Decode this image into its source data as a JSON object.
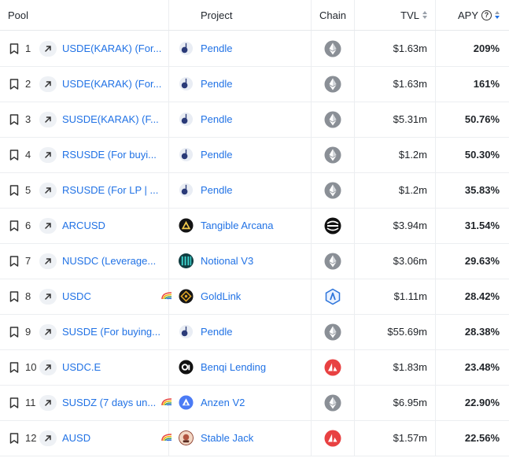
{
  "header": {
    "pool": "Pool",
    "project": "Project",
    "chain": "Chain",
    "tvl": "TVL",
    "apy": "APY",
    "apy_help": "?"
  },
  "rows": [
    {
      "rank": "1",
      "pool": "USDE(KARAK) (For...",
      "project": "Pendle",
      "project_icon": "pendle-icon",
      "chain": "ethereum-icon",
      "tvl": "$1.63m",
      "apy": "209%",
      "stable": false
    },
    {
      "rank": "2",
      "pool": "USDE(KARAK) (For...",
      "project": "Pendle",
      "project_icon": "pendle-icon",
      "chain": "ethereum-icon",
      "tvl": "$1.63m",
      "apy": "161%",
      "stable": false
    },
    {
      "rank": "3",
      "pool": "SUSDE(KARAK) (F...",
      "project": "Pendle",
      "project_icon": "pendle-icon",
      "chain": "ethereum-icon",
      "tvl": "$5.31m",
      "apy": "50.76%",
      "stable": false
    },
    {
      "rank": "4",
      "pool": "RSUSDE (For buyi...",
      "project": "Pendle",
      "project_icon": "pendle-icon",
      "chain": "ethereum-icon",
      "tvl": "$1.2m",
      "apy": "50.30%",
      "stable": false
    },
    {
      "rank": "5",
      "pool": "RSUSDE (For LP | ...",
      "project": "Pendle",
      "project_icon": "pendle-icon",
      "chain": "ethereum-icon",
      "tvl": "$1.2m",
      "apy": "35.83%",
      "stable": false
    },
    {
      "rank": "6",
      "pool": "ARCUSD",
      "project": "Tangible Arcana",
      "project_icon": "tangible-arcana-icon",
      "chain": "real-chain-icon",
      "tvl": "$3.94m",
      "apy": "31.54%",
      "stable": false
    },
    {
      "rank": "7",
      "pool": "NUSDC (Leverage...",
      "project": "Notional V3",
      "project_icon": "notional-icon",
      "chain": "ethereum-icon",
      "tvl": "$3.06m",
      "apy": "29.63%",
      "stable": false
    },
    {
      "rank": "8",
      "pool": "USDC",
      "project": "GoldLink",
      "project_icon": "goldlink-icon",
      "chain": "arbitrum-icon",
      "tvl": "$1.11m",
      "apy": "28.42%",
      "stable": true
    },
    {
      "rank": "9",
      "pool": "SUSDE (For buying...",
      "project": "Pendle",
      "project_icon": "pendle-icon",
      "chain": "ethereum-icon",
      "tvl": "$55.69m",
      "apy": "28.38%",
      "stable": false
    },
    {
      "rank": "10",
      "pool": "USDC.E",
      "project": "Benqi Lending",
      "project_icon": "benqi-icon",
      "chain": "avalanche-icon",
      "tvl": "$1.83m",
      "apy": "23.48%",
      "stable": false
    },
    {
      "rank": "11",
      "pool": "SUSDZ (7 days un...",
      "project": "Anzen V2",
      "project_icon": "anzen-icon",
      "chain": "ethereum-icon",
      "tvl": "$6.95m",
      "apy": "22.90%",
      "stable": true
    },
    {
      "rank": "12",
      "pool": "AUSD",
      "project": "Stable Jack",
      "project_icon": "stable-jack-icon",
      "chain": "avalanche-icon",
      "tvl": "$1.57m",
      "apy": "22.56%",
      "stable": true
    }
  ],
  "colors": {
    "link": "#2172e5",
    "ethereum_bg": "#8a8f96",
    "avalanche": "#e84142",
    "arbitrum": "#2d74da"
  }
}
